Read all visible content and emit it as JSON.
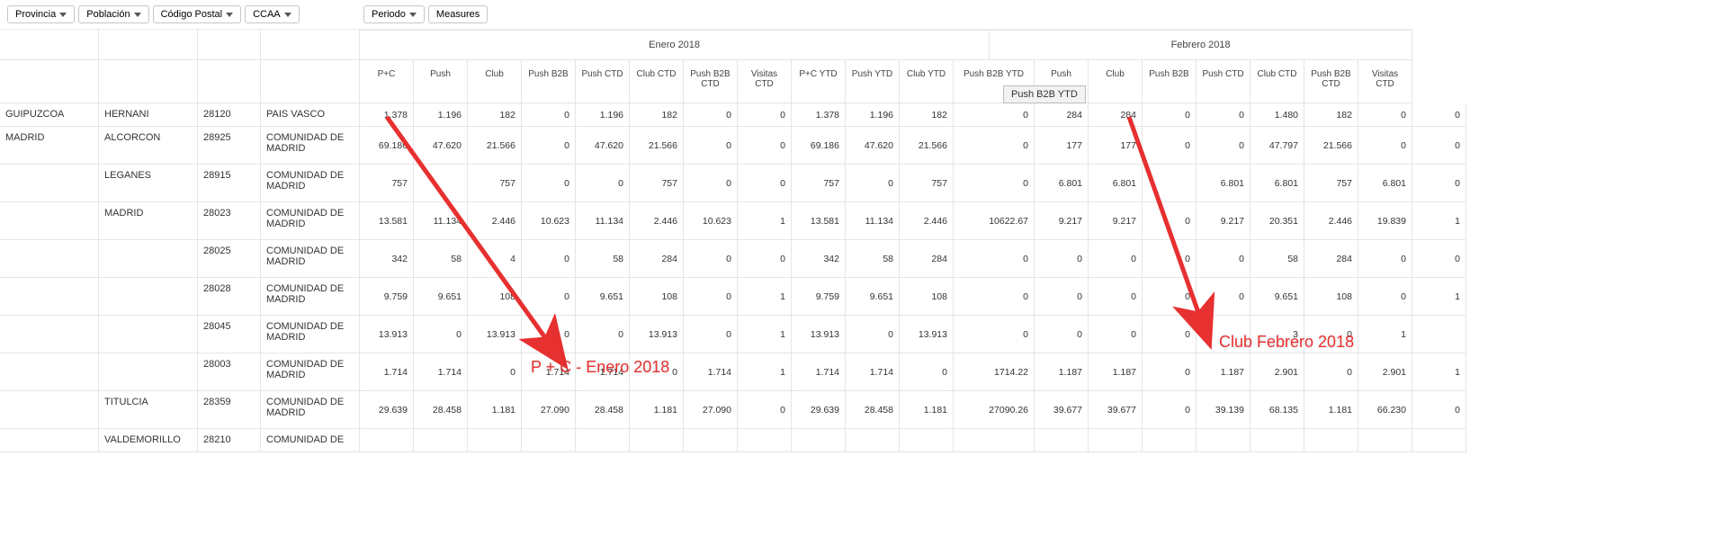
{
  "filters": {
    "provincia": "Provincia",
    "poblacion": "Población",
    "codigo_postal": "Código Postal",
    "ccaa": "CCAA",
    "periodo": "Periodo",
    "measures": "Measures"
  },
  "periods": [
    "Enero 2018",
    "Febrero 2018"
  ],
  "measures": [
    "P+C",
    "Push",
    "Club",
    "Push B2B",
    "Push CTD",
    "Club CTD",
    "Push B2B CTD",
    "Visitas CTD",
    "P+C YTD",
    "Push YTD",
    "Club YTD",
    "Push B2B YTD",
    "Push",
    "Club",
    "Push B2B",
    "Push CTD",
    "Club CTD",
    "Push B2B CTD",
    "Visitas CTD"
  ],
  "tooltip": "Push B2B YTD",
  "row_labels": {
    "provincia": [
      "GUIPUZCOA",
      "MADRID"
    ],
    "poblacion": [
      "HERNANI",
      "ALCORCON",
      "LEGANES",
      "MADRID",
      "",
      "",
      "",
      "",
      "TITULCIA",
      "VALDEMORILLO"
    ],
    "cp": [
      "28120",
      "28925",
      "28915",
      "28023",
      "28025",
      "28028",
      "28045",
      "28003",
      "28359",
      "28210"
    ],
    "ccaa": [
      "PAIS VASCO",
      "COMUNIDAD DE MADRID",
      "COMUNIDAD DE MADRID",
      "COMUNIDAD DE MADRID",
      "COMUNIDAD DE MADRID",
      "COMUNIDAD DE MADRID",
      "COMUNIDAD DE MADRID",
      "COMUNIDAD DE MADRID",
      "COMUNIDAD DE MADRID",
      "COMUNIDAD DE"
    ]
  },
  "rows": [
    [
      "1.378",
      "1.196",
      "182",
      "0",
      "1.196",
      "182",
      "0",
      "0",
      "1.378",
      "1.196",
      "182",
      "0",
      "284",
      "284",
      "0",
      "0",
      "1.480",
      "182",
      "0",
      "0"
    ],
    [
      "69.186",
      "47.620",
      "21.566",
      "0",
      "47.620",
      "21.566",
      "0",
      "0",
      "69.186",
      "47.620",
      "21.566",
      "0",
      "177",
      "177",
      "0",
      "0",
      "47.797",
      "21.566",
      "0",
      "0"
    ],
    [
      "757",
      "",
      "757",
      "0",
      "0",
      "757",
      "0",
      "0",
      "757",
      "0",
      "757",
      "0",
      "6.801",
      "6.801",
      "",
      "6.801",
      "6.801",
      "757",
      "6.801",
      "0"
    ],
    [
      "13.581",
      "11.134",
      "2.446",
      "10.623",
      "11.134",
      "2.446",
      "10.623",
      "1",
      "13.581",
      "11.134",
      "2.446",
      "10622.67",
      "9.217",
      "9.217",
      "0",
      "9.217",
      "20.351",
      "2.446",
      "19.839",
      "1"
    ],
    [
      "342",
      "58",
      "4",
      "0",
      "58",
      "284",
      "0",
      "0",
      "342",
      "58",
      "284",
      "0",
      "0",
      "0",
      "0",
      "0",
      "58",
      "284",
      "0",
      "0"
    ],
    [
      "9.759",
      "9.651",
      "108",
      "0",
      "9.651",
      "108",
      "0",
      "1",
      "9.759",
      "9.651",
      "108",
      "0",
      "0",
      "0",
      "0",
      "0",
      "9.651",
      "108",
      "0",
      "1"
    ],
    [
      "13.913",
      "0",
      "13.913",
      "0",
      "0",
      "13.913",
      "0",
      "1",
      "13.913",
      "0",
      "13.913",
      "0",
      "0",
      "0",
      "0",
      "",
      "3",
      "0",
      "1",
      ""
    ],
    [
      "1.714",
      "1.714",
      "0",
      "1.714",
      "1.714",
      "0",
      "1.714",
      "1",
      "1.714",
      "1.714",
      "0",
      "1714.22",
      "1.187",
      "1.187",
      "0",
      "1.187",
      "2.901",
      "0",
      "2.901",
      "1"
    ],
    [
      "29.639",
      "28.458",
      "1.181",
      "27.090",
      "28.458",
      "1.181",
      "27.090",
      "0",
      "29.639",
      "28.458",
      "1.181",
      "27090.26",
      "39.677",
      "39.677",
      "0",
      "39.139",
      "68.135",
      "1.181",
      "66.230",
      "0"
    ]
  ],
  "annotations": {
    "left": "P + C - Enero 2018",
    "right": "Club Febrero 2018"
  }
}
